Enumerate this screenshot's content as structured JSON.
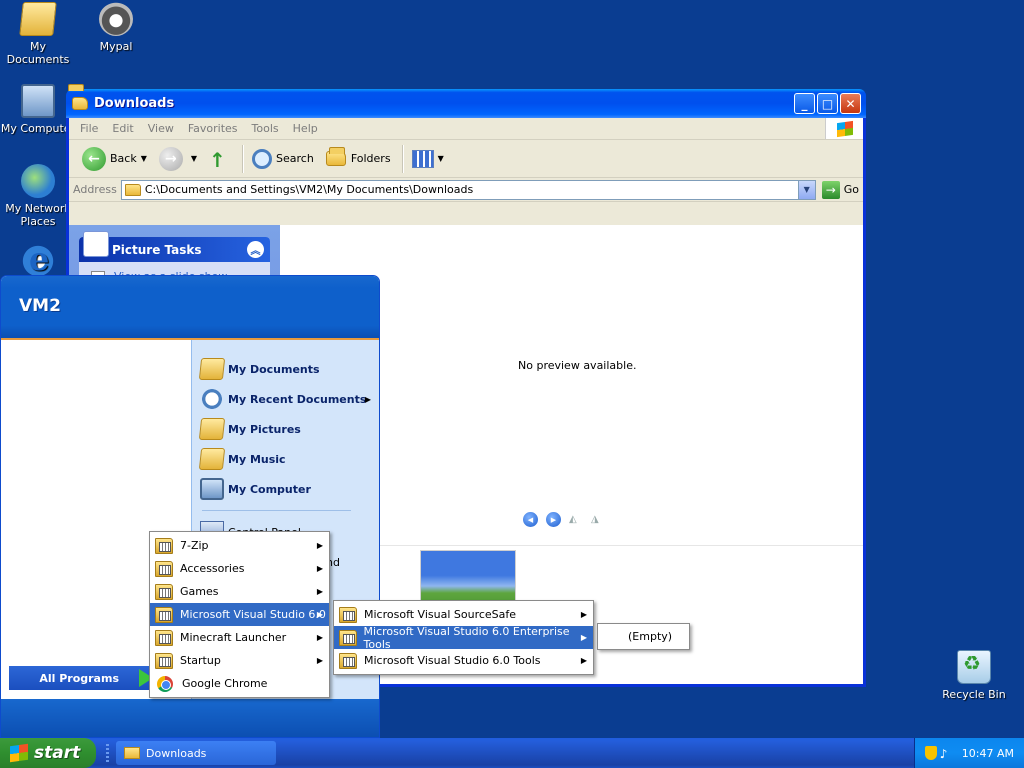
{
  "desktop": {
    "icons": [
      {
        "label": "My Documents",
        "icon": "my-documents-icon"
      },
      {
        "label": "Mypal",
        "icon": "mypal-icon"
      },
      {
        "label": "My Computer",
        "icon": "my-computer-icon"
      },
      {
        "label": "My Network Places",
        "icon": "network-icon"
      },
      {
        "label": "Recycle Bin",
        "icon": "recycle-bin-icon"
      }
    ]
  },
  "window": {
    "title": "Downloads",
    "menu": [
      "File",
      "Edit",
      "View",
      "Favorites",
      "Tools",
      "Help"
    ],
    "toolbar": {
      "back": "Back",
      "search": "Search",
      "folders": "Folders"
    },
    "address": {
      "label": "Address",
      "value": "C:\\Documents and Settings\\VM2\\My Documents\\Downloads",
      "go": "Go"
    },
    "tasks": {
      "title": "Picture Tasks",
      "items": [
        "View as a slide show"
      ]
    },
    "preview": {
      "message": "No preview available."
    }
  },
  "startmenu": {
    "user": "VM2",
    "right_items": [
      {
        "label": "My Documents"
      },
      {
        "label": "My Recent Documents",
        "has_submenu": true
      },
      {
        "label": "My Pictures"
      },
      {
        "label": "My Music"
      },
      {
        "label": "My Computer"
      }
    ],
    "control_panel": "Control Panel",
    "partial_item": "nd",
    "all_programs": "All Programs"
  },
  "programs_menu": {
    "items": [
      {
        "label": "7-Zip",
        "has_submenu": true
      },
      {
        "label": "Accessories",
        "has_submenu": true
      },
      {
        "label": "Games",
        "has_submenu": true
      },
      {
        "label": "Microsoft Visual Studio 6.0",
        "has_submenu": true,
        "selected": true
      },
      {
        "label": "Minecraft Launcher",
        "has_submenu": true
      },
      {
        "label": "Startup",
        "has_submenu": true
      },
      {
        "label": "Google Chrome",
        "has_submenu": false
      }
    ]
  },
  "vs_menu": {
    "items": [
      {
        "label": "Microsoft Visual SourceSafe",
        "has_submenu": true
      },
      {
        "label": "Microsoft Visual Studio 6.0 Enterprise Tools",
        "has_submenu": true,
        "selected": true
      },
      {
        "label": "Microsoft Visual Studio 6.0 Tools",
        "has_submenu": true
      }
    ]
  },
  "tools_menu": {
    "empty": "(Empty)"
  },
  "taskbar": {
    "start": "start",
    "app": "Downloads",
    "clock": "10:47 AM"
  }
}
